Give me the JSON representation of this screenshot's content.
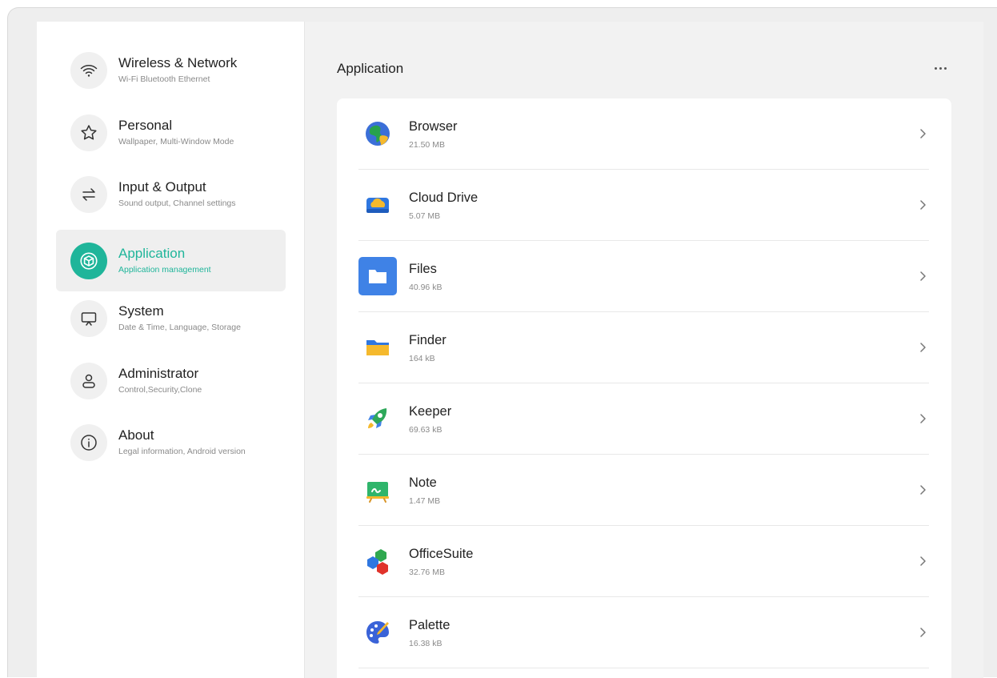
{
  "sidebar": {
    "items": [
      {
        "title": "Wireless & Network",
        "subtitle": "Wi-Fi Bluetooth Ethernet",
        "icon": "wifi-icon"
      },
      {
        "title": "Personal",
        "subtitle": "Wallpaper, Multi-Window Mode",
        "icon": "star-icon"
      },
      {
        "title": "Input & Output",
        "subtitle": "Sound output, Channel settings",
        "icon": "swap-arrows-icon"
      },
      {
        "title": "Application",
        "subtitle": "Application management",
        "icon": "cube-icon",
        "active": true
      },
      {
        "title": "System",
        "subtitle": "Date & Time, Language, Storage",
        "icon": "display-icon"
      },
      {
        "title": "Administrator",
        "subtitle": "Control,Security,Clone",
        "icon": "user-icon"
      },
      {
        "title": "About",
        "subtitle": "Legal information, Android version",
        "icon": "info-icon"
      }
    ]
  },
  "main": {
    "title": "Application",
    "more_icon": "more-horizontal-icon",
    "apps": [
      {
        "name": "Browser",
        "size": "21.50 MB",
        "icon": "browser-icon"
      },
      {
        "name": "Cloud Drive",
        "size": "5.07 MB",
        "icon": "cloud-drive-icon"
      },
      {
        "name": "Files",
        "size": "40.96 kB",
        "icon": "files-icon"
      },
      {
        "name": "Finder",
        "size": "164 kB",
        "icon": "finder-icon"
      },
      {
        "name": "Keeper",
        "size": "69.63 kB",
        "icon": "keeper-rocket-icon"
      },
      {
        "name": "Note",
        "size": "1.47 MB",
        "icon": "note-board-icon"
      },
      {
        "name": "OfficeSuite",
        "size": "32.76 MB",
        "icon": "officesuite-icon"
      },
      {
        "name": "Palette",
        "size": "16.38 kB",
        "icon": "palette-icon"
      }
    ]
  },
  "colors": {
    "accent": "#1fb59a",
    "background": "#f2f2f2"
  }
}
